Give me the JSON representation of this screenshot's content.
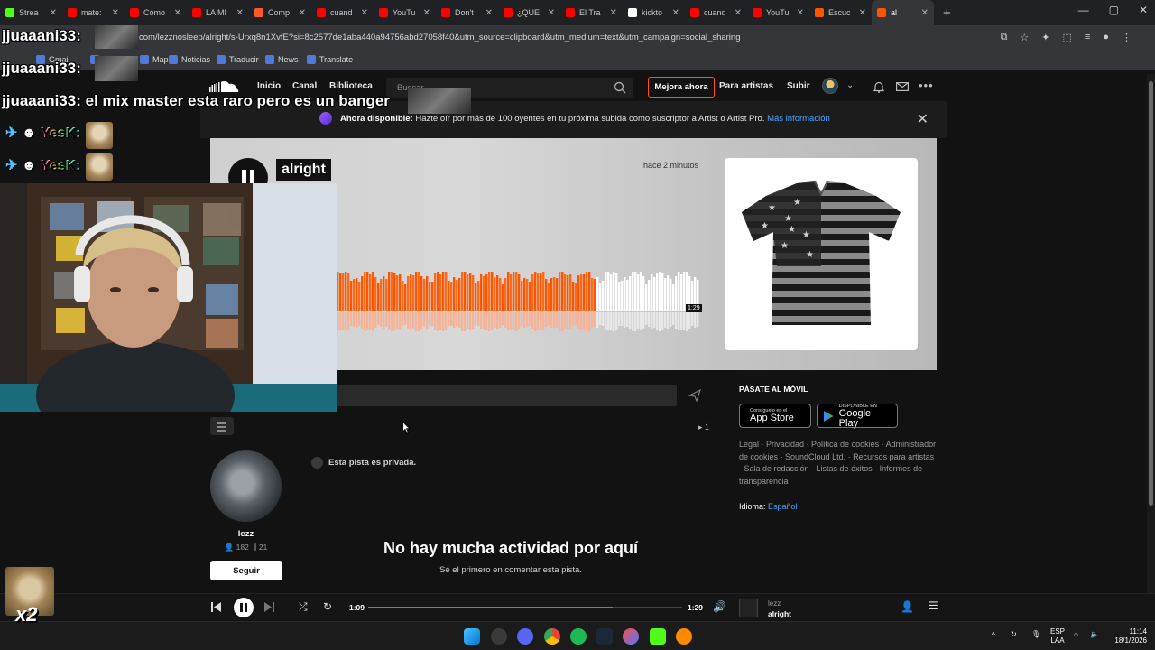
{
  "browser": {
    "tabs": [
      {
        "title": "Strea",
        "color": "#53fc18",
        "active": false
      },
      {
        "title": "mate:",
        "color": "#ff0000",
        "active": false
      },
      {
        "title": "Cómo",
        "color": "#ff0000",
        "active": false
      },
      {
        "title": "LA MI",
        "color": "#ff0000",
        "active": false
      },
      {
        "title": "Comp",
        "color": "#ff5a2a",
        "active": false
      },
      {
        "title": "cuand",
        "color": "#ff0000",
        "active": false
      },
      {
        "title": "YouTu",
        "color": "#ff0000",
        "active": false
      },
      {
        "title": "Don't",
        "color": "#ff0000",
        "active": false
      },
      {
        "title": "¿QUE",
        "color": "#ff0000",
        "active": false
      },
      {
        "title": "El Tra",
        "color": "#ff0000",
        "active": false
      },
      {
        "title": "kickto",
        "color": "#ffffff",
        "active": false
      },
      {
        "title": "cuand",
        "color": "#ff0000",
        "active": false
      },
      {
        "title": "YouTu",
        "color": "#ff0000",
        "active": false
      },
      {
        "title": "Escuc",
        "color": "#ff5500",
        "active": false
      },
      {
        "title": "al",
        "color": "#ff5500",
        "active": true
      }
    ],
    "url": "com/lezznosleep/alright/s-Urxq8n1XvfE?si=8c2577de1aba440a94756abd27058f40&utm_source=clipboard&utm_medium=text&utm_campaign=social_sharing",
    "bookmarks": [
      "Gmail",
      "Y",
      "Maps",
      "Noticias",
      "Traducir",
      "News",
      "Translate"
    ]
  },
  "sc_header": {
    "nav": [
      "Inicio",
      "Canal",
      "Biblioteca"
    ],
    "search_placeholder": "Buscar",
    "upgrade": "Mejora ahora",
    "for_artists": "Para artistas",
    "upload": "Subir"
  },
  "banner": {
    "bold": "Ahora disponible:",
    "text": " Hazte oír por más de 100 oyentes en tu próxima subida como suscriptor a Artist o Artist Pro. ",
    "link": "Más información"
  },
  "track": {
    "title": "alright",
    "uploaded": "hace 2 minutos",
    "duration": "1:29",
    "progress": 0.72
  },
  "comments": {
    "reposts": "1",
    "private_note": "Esta pista es privada.",
    "empty_title": "No hay mucha actividad por aquí",
    "empty_sub": "Sé el primero en comentar esta pista."
  },
  "artist": {
    "name": "lezz",
    "followers": "182",
    "tracks": "21",
    "follow": "Seguir"
  },
  "sidebar": {
    "mobile_heading": "PÁSATE AL MÓVIL",
    "app_store_small": "Consíguelo en el",
    "app_store_big": "App Store",
    "play_small": "DISPONIBLE EN",
    "play_big": "Google Play",
    "footer_links": "Legal · Privacidad · Política de cookies · Administrador de cookies · SoundCloud Ltd. · Recursos para artistas · Sala de redacción · Listas de éxitos · Informes de transparencia",
    "lang_label": "Idioma:",
    "lang_value": "Español"
  },
  "player": {
    "elapsed": "1:09",
    "total": "1:29",
    "progress": 0.78,
    "artist": "lezz",
    "title": "alright"
  },
  "taskbar": {
    "lang_top": "ESP",
    "lang_bottom": "LAA",
    "time": "11:14",
    "date": "18/1/2026"
  },
  "overlay": {
    "chat": [
      {
        "user": "jjuaaani33:",
        "message": ""
      },
      {
        "user": "jjuaaani33:",
        "message": ""
      },
      {
        "user": "jjuaaani33:",
        "message": "el mix master esta raro pero es un banger"
      }
    ],
    "yesk": [
      "YesK:",
      "YesK:"
    ],
    "multiplier": "x2"
  },
  "colors": {
    "accent": "#ff5500",
    "link": "#4aa3ff"
  }
}
